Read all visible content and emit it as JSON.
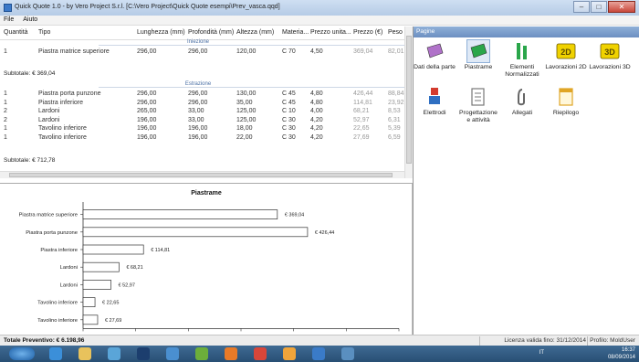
{
  "window": {
    "title": "Quick Quote 1.0 - by Vero Project S.r.l. [C:\\Vero Project\\Quick Quote esempi\\Prev_vasca.qqd]"
  },
  "menu": [
    "File",
    "Aiuto"
  ],
  "table": {
    "columns": [
      "Quantità",
      "Tipo",
      "Lunghezza (mm)",
      "Profondità (mm)",
      "Altezza (mm)",
      "Materia...",
      "Prezzo unita...",
      "Prezzo (€)",
      "Peso"
    ],
    "group1_label": "Iniezione",
    "group2_label": "Estrazione",
    "rows1": [
      {
        "qty": "1",
        "type": "Piastra matrice superiore",
        "len": "296,00",
        "depth": "296,00",
        "height": "120,00",
        "material": "C 70",
        "unit": "4,50",
        "price": "369,04",
        "weight": "82,01"
      }
    ],
    "subtotal1": "Subtotale: € 369,04",
    "rows2": [
      {
        "qty": "1",
        "type": "Piastra porta punzone",
        "len": "296,00",
        "depth": "296,00",
        "height": "130,00",
        "material": "C 45",
        "unit": "4,80",
        "price": "426,44",
        "weight": "88,84"
      },
      {
        "qty": "1",
        "type": "Piastra inferiore",
        "len": "296,00",
        "depth": "296,00",
        "height": "35,00",
        "material": "C 45",
        "unit": "4,80",
        "price": "114,81",
        "weight": "23,92"
      },
      {
        "qty": "2",
        "type": "Lardoni",
        "len": "265,00",
        "depth": "33,00",
        "height": "125,00",
        "material": "C 10",
        "unit": "4,00",
        "price": "68,21",
        "weight": "8,53"
      },
      {
        "qty": "2",
        "type": "Lardoni",
        "len": "196,00",
        "depth": "33,00",
        "height": "125,00",
        "material": "C 30",
        "unit": "4,20",
        "price": "52,97",
        "weight": "6,31"
      },
      {
        "qty": "1",
        "type": "Tavolino inferiore",
        "len": "196,00",
        "depth": "196,00",
        "height": "18,00",
        "material": "C 30",
        "unit": "4,20",
        "price": "22,65",
        "weight": "5,39"
      },
      {
        "qty": "1",
        "type": "Tavolino inferiore",
        "len": "196,00",
        "depth": "196,00",
        "height": "22,00",
        "material": "C 30",
        "unit": "4,20",
        "price": "27,69",
        "weight": "6,59"
      }
    ],
    "subtotal2": "Subtotale: € 712,78"
  },
  "chart_data": {
    "type": "bar",
    "title": "Piastrame",
    "categories": [
      "Piastra matrice superiore",
      "Piastra porta punzone",
      "Piastra inferiore",
      "Lardoni",
      "Lardoni",
      "Tavolino inferiore",
      "Tavolino inferiore"
    ],
    "values": [
      369.04,
      426.44,
      114.81,
      68.21,
      52.97,
      22.65,
      27.69
    ],
    "labels": [
      "€ 369,04",
      "€ 426,44",
      "€ 114,81",
      "€ 68,21",
      "€ 52,97",
      "€ 22,65",
      "€ 27,69"
    ],
    "xlim": [
      0,
      600
    ],
    "xticks": [
      0,
      100,
      200,
      300,
      400,
      500,
      600
    ],
    "grid": false
  },
  "right_panel": {
    "header": "Pagine",
    "tiles": [
      {
        "label": "Dati della parte",
        "icon": "part-data-icon",
        "color": "#b072c9"
      },
      {
        "label": "Piastrame",
        "icon": "plates-icon",
        "color": "#2aa64a"
      },
      {
        "label": "Elementi Normalizzati",
        "icon": "standard-parts-icon",
        "color": "#2aa64a"
      },
      {
        "label": "Lavorazioni 2D",
        "icon": "machining-2d-icon",
        "color": "#f0d200"
      },
      {
        "label": "Lavorazioni 3D",
        "icon": "machining-3d-icon",
        "color": "#f0d200"
      },
      {
        "label": "Elettrodi",
        "icon": "electrodes-icon",
        "color": "#d33b2e"
      },
      {
        "label": "Progettazione e attività",
        "icon": "design-activity-icon",
        "color": "#777777"
      },
      {
        "label": "Allegati",
        "icon": "attachments-icon",
        "color": "#666666"
      },
      {
        "label": "Riepilogo",
        "icon": "summary-icon",
        "color": "#e0a526"
      }
    ]
  },
  "status": {
    "total": "Totale Preventivo: € 6.198,96",
    "license": "Licenza valida fino: 31/12/2014",
    "profile": "Profilo: MoldUser"
  },
  "taskbar": {
    "lang": "IT",
    "time": "16:37",
    "date": "08/09/2014"
  }
}
